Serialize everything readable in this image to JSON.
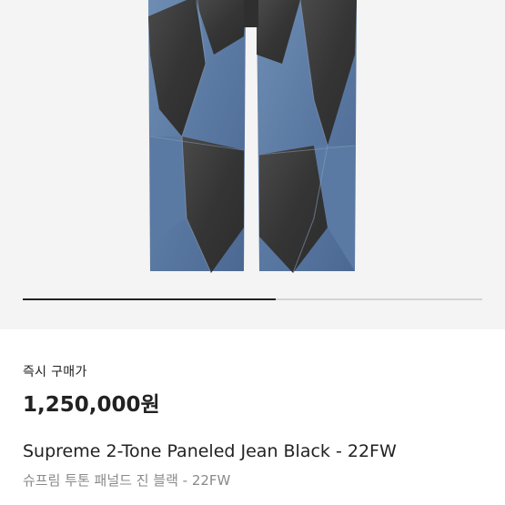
{
  "product": {
    "image_alt": "",
    "purchase_label": "즉시 구매가",
    "price": "1,250,000원",
    "name": "Supreme 2-Tone Paneled Jean Black - 22FW",
    "name_ko": "슈프림 투톤 패널드 진 블랙 - 22FW"
  },
  "gallery": {
    "progress": 0.55,
    "track_color": "#d3d3d3",
    "fill_color": "#222222"
  },
  "colors": {
    "denim_blue": "#5f7fa8",
    "denim_black": "#3e3e3e",
    "background": "#f4f4f4"
  }
}
